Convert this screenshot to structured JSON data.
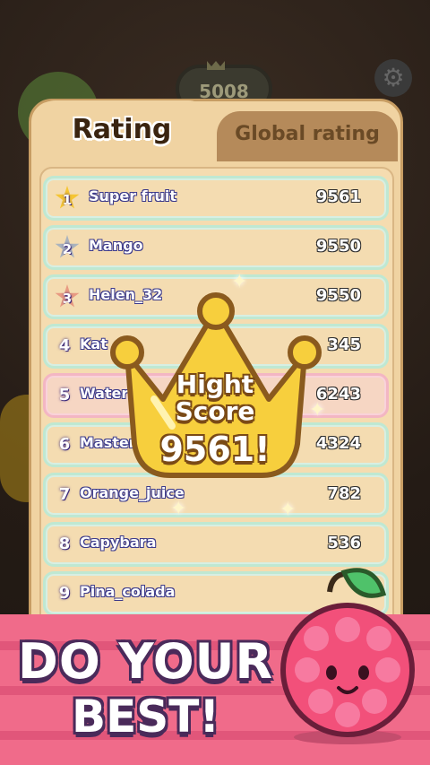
{
  "background": {
    "score": "5008",
    "gear_icon": "gear-icon"
  },
  "tabs": {
    "active": "Rating",
    "inactive": "Global rating"
  },
  "rows": [
    {
      "rank": "1",
      "name": "Super fruit",
      "score": "9561",
      "style": "gold"
    },
    {
      "rank": "2",
      "name": "Mango",
      "score": "9550",
      "style": "silver"
    },
    {
      "rank": "3",
      "name": "Helen_32",
      "score": "9550",
      "style": "bronze"
    },
    {
      "rank": "4",
      "name": "Kat",
      "score": "345",
      "style": "plain"
    },
    {
      "rank": "5",
      "name": "Watern",
      "score": "6243",
      "style": "highlight"
    },
    {
      "rank": "6",
      "name": "Master_",
      "score": "4324",
      "style": "plain"
    },
    {
      "rank": "7",
      "name": "Orange_juice",
      "score": "782",
      "style": "plain"
    },
    {
      "rank": "8",
      "name": "Capybara",
      "score": "536",
      "style": "plain"
    },
    {
      "rank": "9",
      "name": "Pina_colada",
      "score": "",
      "style": "plain"
    }
  ],
  "highscore": {
    "line1": "Hight",
    "line2": "Score",
    "value": "9561!"
  },
  "banner": {
    "line1": "DO YOUR",
    "line2": "BEST!"
  },
  "colors": {
    "panel": "#f0d3a2",
    "row_border": "#bfe8d2",
    "highlight_border": "#f3b6c3",
    "banner": "#f06b8a",
    "crown": "#f7cf3d"
  }
}
